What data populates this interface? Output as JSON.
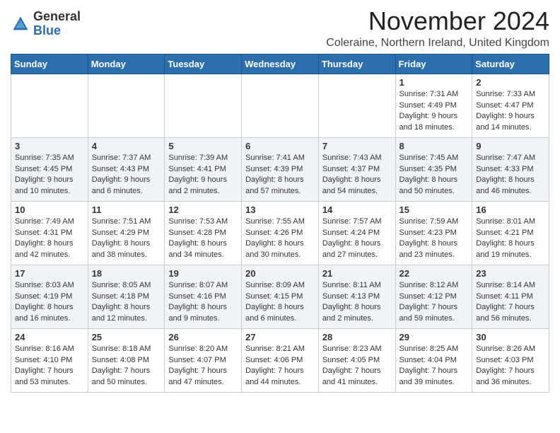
{
  "header": {
    "logo_general": "General",
    "logo_blue": "Blue",
    "month_title": "November 2024",
    "location": "Coleraine, Northern Ireland, United Kingdom"
  },
  "weekdays": [
    "Sunday",
    "Monday",
    "Tuesday",
    "Wednesday",
    "Thursday",
    "Friday",
    "Saturday"
  ],
  "weeks": [
    [
      {
        "day": "",
        "info": ""
      },
      {
        "day": "",
        "info": ""
      },
      {
        "day": "",
        "info": ""
      },
      {
        "day": "",
        "info": ""
      },
      {
        "day": "",
        "info": ""
      },
      {
        "day": "1",
        "info": "Sunrise: 7:31 AM\nSunset: 4:49 PM\nDaylight: 9 hours\nand 18 minutes."
      },
      {
        "day": "2",
        "info": "Sunrise: 7:33 AM\nSunset: 4:47 PM\nDaylight: 9 hours\nand 14 minutes."
      }
    ],
    [
      {
        "day": "3",
        "info": "Sunrise: 7:35 AM\nSunset: 4:45 PM\nDaylight: 9 hours\nand 10 minutes."
      },
      {
        "day": "4",
        "info": "Sunrise: 7:37 AM\nSunset: 4:43 PM\nDaylight: 9 hours\nand 6 minutes."
      },
      {
        "day": "5",
        "info": "Sunrise: 7:39 AM\nSunset: 4:41 PM\nDaylight: 9 hours\nand 2 minutes."
      },
      {
        "day": "6",
        "info": "Sunrise: 7:41 AM\nSunset: 4:39 PM\nDaylight: 8 hours\nand 57 minutes."
      },
      {
        "day": "7",
        "info": "Sunrise: 7:43 AM\nSunset: 4:37 PM\nDaylight: 8 hours\nand 54 minutes."
      },
      {
        "day": "8",
        "info": "Sunrise: 7:45 AM\nSunset: 4:35 PM\nDaylight: 8 hours\nand 50 minutes."
      },
      {
        "day": "9",
        "info": "Sunrise: 7:47 AM\nSunset: 4:33 PM\nDaylight: 8 hours\nand 46 minutes."
      }
    ],
    [
      {
        "day": "10",
        "info": "Sunrise: 7:49 AM\nSunset: 4:31 PM\nDaylight: 8 hours\nand 42 minutes."
      },
      {
        "day": "11",
        "info": "Sunrise: 7:51 AM\nSunset: 4:29 PM\nDaylight: 8 hours\nand 38 minutes."
      },
      {
        "day": "12",
        "info": "Sunrise: 7:53 AM\nSunset: 4:28 PM\nDaylight: 8 hours\nand 34 minutes."
      },
      {
        "day": "13",
        "info": "Sunrise: 7:55 AM\nSunset: 4:26 PM\nDaylight: 8 hours\nand 30 minutes."
      },
      {
        "day": "14",
        "info": "Sunrise: 7:57 AM\nSunset: 4:24 PM\nDaylight: 8 hours\nand 27 minutes."
      },
      {
        "day": "15",
        "info": "Sunrise: 7:59 AM\nSunset: 4:23 PM\nDaylight: 8 hours\nand 23 minutes."
      },
      {
        "day": "16",
        "info": "Sunrise: 8:01 AM\nSunset: 4:21 PM\nDaylight: 8 hours\nand 19 minutes."
      }
    ],
    [
      {
        "day": "17",
        "info": "Sunrise: 8:03 AM\nSunset: 4:19 PM\nDaylight: 8 hours\nand 16 minutes."
      },
      {
        "day": "18",
        "info": "Sunrise: 8:05 AM\nSunset: 4:18 PM\nDaylight: 8 hours\nand 12 minutes."
      },
      {
        "day": "19",
        "info": "Sunrise: 8:07 AM\nSunset: 4:16 PM\nDaylight: 8 hours\nand 9 minutes."
      },
      {
        "day": "20",
        "info": "Sunrise: 8:09 AM\nSunset: 4:15 PM\nDaylight: 8 hours\nand 6 minutes."
      },
      {
        "day": "21",
        "info": "Sunrise: 8:11 AM\nSunset: 4:13 PM\nDaylight: 8 hours\nand 2 minutes."
      },
      {
        "day": "22",
        "info": "Sunrise: 8:12 AM\nSunset: 4:12 PM\nDaylight: 7 hours\nand 59 minutes."
      },
      {
        "day": "23",
        "info": "Sunrise: 8:14 AM\nSunset: 4:11 PM\nDaylight: 7 hours\nand 56 minutes."
      }
    ],
    [
      {
        "day": "24",
        "info": "Sunrise: 8:16 AM\nSunset: 4:10 PM\nDaylight: 7 hours\nand 53 minutes."
      },
      {
        "day": "25",
        "info": "Sunrise: 8:18 AM\nSunset: 4:08 PM\nDaylight: 7 hours\nand 50 minutes."
      },
      {
        "day": "26",
        "info": "Sunrise: 8:20 AM\nSunset: 4:07 PM\nDaylight: 7 hours\nand 47 minutes."
      },
      {
        "day": "27",
        "info": "Sunrise: 8:21 AM\nSunset: 4:06 PM\nDaylight: 7 hours\nand 44 minutes."
      },
      {
        "day": "28",
        "info": "Sunrise: 8:23 AM\nSunset: 4:05 PM\nDaylight: 7 hours\nand 41 minutes."
      },
      {
        "day": "29",
        "info": "Sunrise: 8:25 AM\nSunset: 4:04 PM\nDaylight: 7 hours\nand 39 minutes."
      },
      {
        "day": "30",
        "info": "Sunrise: 8:26 AM\nSunset: 4:03 PM\nDaylight: 7 hours\nand 36 minutes."
      }
    ]
  ]
}
